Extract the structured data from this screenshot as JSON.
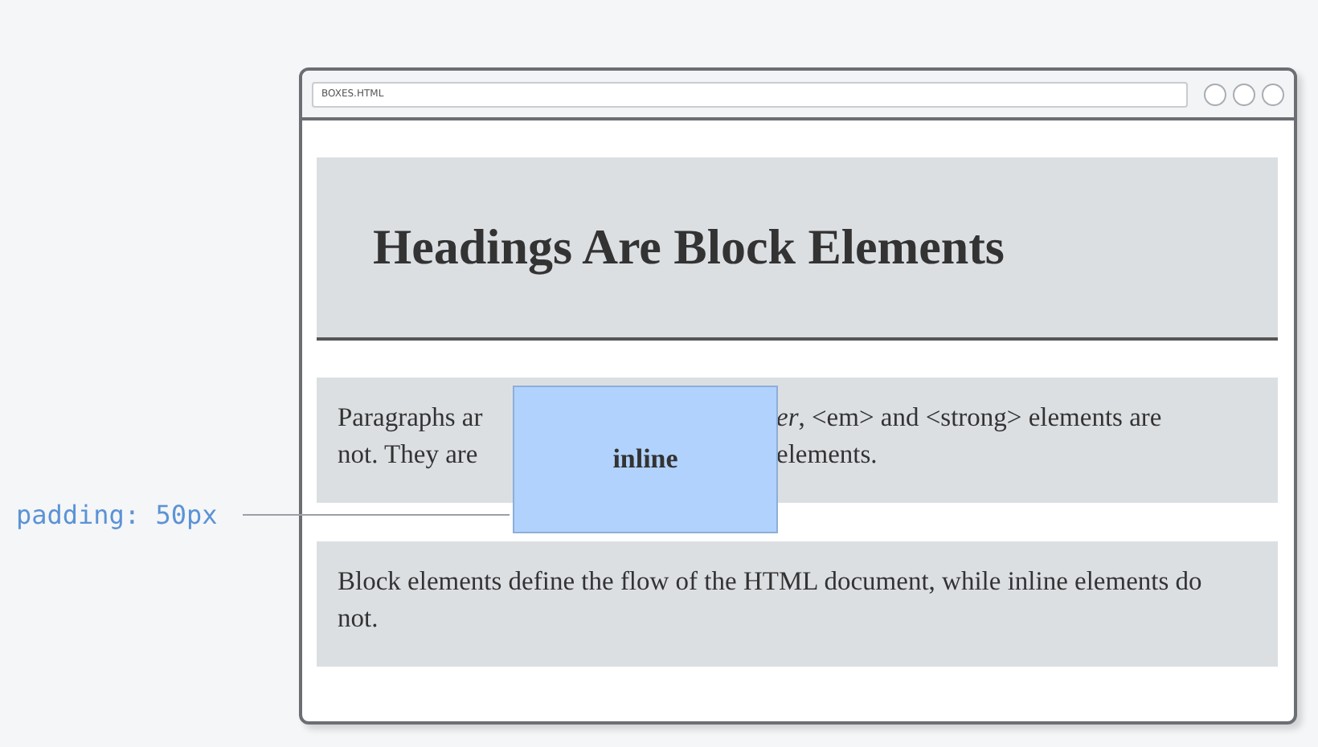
{
  "annotation": {
    "label": "padding: 50px"
  },
  "window": {
    "address": "BOXES.HTML"
  },
  "heading": "Headings Are Block Elements",
  "paragraphs": [
    {
      "lines": [
        {
          "left": "Paragraphs ar",
          "right": "*er*, <em> and <strong> elements are"
        },
        {
          "left": "not. They are",
          "right": "elements."
        }
      ]
    },
    {
      "text": "Block elements define the flow of the HTML document, while inline elements do not."
    }
  ],
  "overlay": {
    "label": "inline"
  }
}
